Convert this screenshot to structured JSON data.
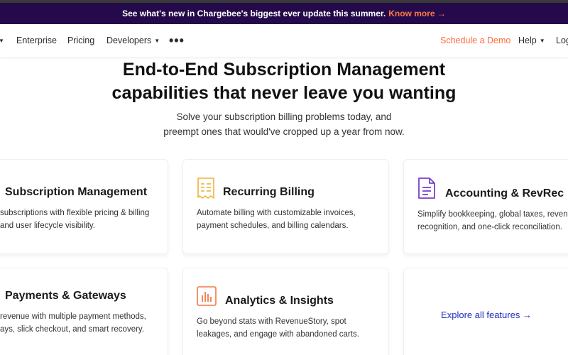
{
  "announcement": {
    "text": "See what's new in Chargebee's biggest ever update this summer.",
    "link": "Know more →"
  },
  "nav": {
    "items": [
      "Enterprise",
      "Pricing",
      "Developers"
    ],
    "more_label": "•••",
    "demo": "Schedule a Demo",
    "help": "Help",
    "login": "Log"
  },
  "hero": {
    "title_line1": "End-to-End Subscription Management",
    "title_line2": "capabilities that never leave you wanting",
    "subtitle_line1": "Solve your subscription billing problems today, and",
    "subtitle_line2": "preempt ones that would've cropped up a year from now."
  },
  "cards": {
    "subscription": {
      "title": "Subscription Management",
      "line1": "subscriptions with flexible pricing & billing",
      "line2": "and user lifecycle visibility."
    },
    "billing": {
      "title": "Recurring Billing",
      "line1": "Automate billing with customizable invoices,",
      "line2": "payment schedules, and billing calendars."
    },
    "accounting": {
      "title": "Accounting & RevRec",
      "line1": "Simplify bookkeeping, global taxes, reven",
      "line2": "recognition, and one-click reconciliation."
    },
    "payments": {
      "title": "Payments & Gateways",
      "line1": "revenue with multiple payment methods,",
      "line2": "ays, slick checkout, and smart recovery."
    },
    "analytics": {
      "title": "Analytics & Insights",
      "line1": "Go beyond stats with RevenueStory, spot",
      "line2": "leakages, and engage with abandoned carts."
    },
    "explore": {
      "label": "Explore all features →"
    }
  },
  "colors": {
    "banner": "#240a4a",
    "accent_orange": "#ff6b3d",
    "billing_icon": "#f2b13a",
    "accounting_icon": "#7b3fd1",
    "analytics_icon": "#f07a45",
    "link_blue": "#1d2fb8"
  }
}
